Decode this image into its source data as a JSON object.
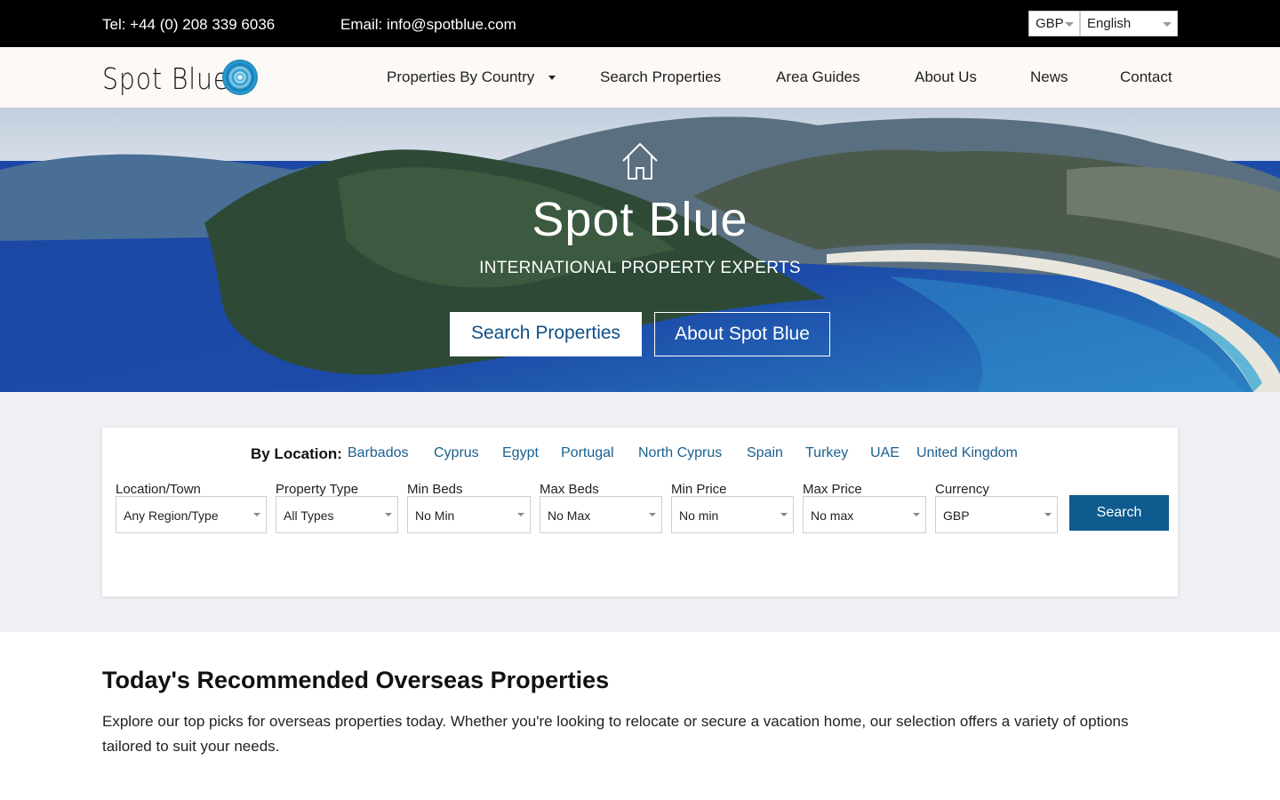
{
  "topbar": {
    "tel": "Tel: +44 (0) 208 339 6036",
    "email": "Email: info@spotblue.com",
    "currency": "GBP",
    "language": "English"
  },
  "nav": {
    "logo_text": "Spot Blue",
    "items": [
      "Properties By Country",
      "Search Properties",
      "Area Guides",
      "About Us",
      "News",
      "Contact"
    ]
  },
  "hero": {
    "title": "Spot Blue",
    "subtitle": "INTERNATIONAL PROPERTY EXPERTS",
    "primary_button": "Search Properties",
    "secondary_button": "About Spot Blue"
  },
  "search": {
    "by_location_label": "By Location:",
    "locations": [
      "Barbados",
      "Cyprus",
      "Egypt",
      "Portugal",
      "North Cyprus",
      "Spain",
      "Turkey",
      "UAE",
      "United Kingdom"
    ],
    "fields": [
      {
        "label": "Location/Town",
        "value": "Any Region/Type"
      },
      {
        "label": "Property Type",
        "value": "All Types"
      },
      {
        "label": "Min Beds",
        "value": "No Min"
      },
      {
        "label": "Max Beds",
        "value": "No Max"
      },
      {
        "label": "Min Price",
        "value": "No min"
      },
      {
        "label": "Max Price",
        "value": "No max"
      },
      {
        "label": "Currency",
        "value": "GBP"
      }
    ],
    "button": "Search"
  },
  "recommended": {
    "title": "Today's Recommended Overseas Properties",
    "description": "Explore our top picks for overseas properties today. Whether you're looking to relocate or secure a vacation home, our selection offers a variety of options tailored to suit your needs."
  },
  "colors": {
    "topbar": "#000000",
    "navbar": "#fdf9f6",
    "brand_blue": "#0f5b8f",
    "link_blue": "#1a5f8f",
    "search_bg": "#eef0f3"
  }
}
